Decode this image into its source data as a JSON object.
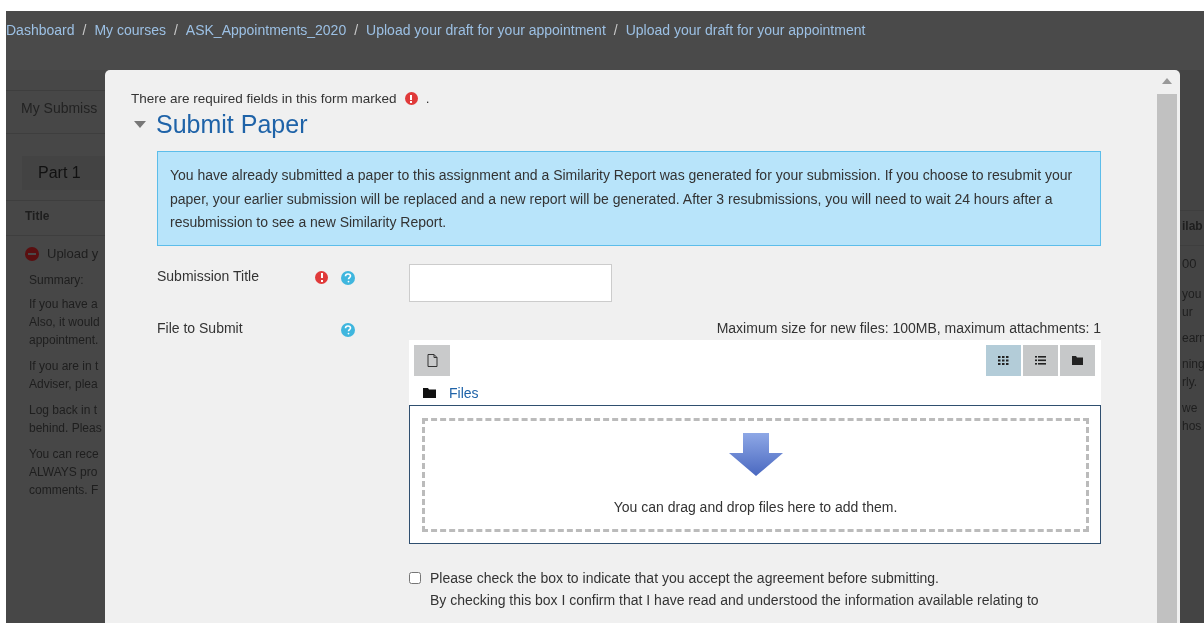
{
  "breadcrumb_separator": "/",
  "breadcrumb": [
    "Dashboard",
    "My courses",
    "ASK_Appointments_2020",
    "Upload your draft for your appointment",
    "Upload your draft for your appointment"
  ],
  "background": {
    "left": [
      {
        "kind": "tab",
        "text": "My Submiss"
      },
      {
        "kind": "part",
        "text": "Part 1"
      },
      {
        "kind": "head",
        "text": "Title"
      },
      {
        "kind": "status",
        "text": "Upload y"
      },
      {
        "kind": "line",
        "text": "Summary:"
      },
      {
        "kind": "para",
        "lines": [
          "If you have a",
          "Also, it would",
          "appointment."
        ]
      },
      {
        "kind": "para",
        "lines": [
          "If you are in t",
          "Adviser, plea"
        ]
      },
      {
        "kind": "para",
        "lines": [
          "Log back in t",
          "behind. Pleas"
        ]
      },
      {
        "kind": "para",
        "lines": [
          "You can rece",
          "ALWAYS pro",
          "comments. F"
        ]
      }
    ],
    "right": [
      {
        "kind": "head",
        "text": "ilab"
      },
      {
        "kind": "status",
        "text": "00"
      },
      {
        "kind": "para",
        "lines": [
          "you",
          "ur"
        ]
      },
      {
        "kind": "para",
        "lines": [
          "earn"
        ]
      },
      {
        "kind": "para",
        "lines": [
          "ning",
          "rly."
        ]
      },
      {
        "kind": "para",
        "lines": [
          "we",
          "hos"
        ]
      }
    ]
  },
  "modal": {
    "required_note": {
      "text": "There are required fields in this form marked",
      "end": "."
    },
    "section": {
      "title": "Submit Paper",
      "expanded": true
    },
    "notice": "You have already submitted a paper to this assignment and a Similarity Report was generated for your submission. If you choose to resubmit your paper, your earlier submission will be replaced and a new report will be generated. After 3 resubmissions, you will need to wait 24 hours after a resubmission to see a new Similarity Report.",
    "fields": [
      {
        "kind": "text",
        "label": "Submission Title",
        "required": true,
        "help": true
      },
      {
        "kind": "filepicker",
        "label": "File to Submit",
        "required": false,
        "help": true
      }
    ],
    "filepicker": {
      "limits": "Maximum size for new files: 100MB, maximum attachments: 1",
      "folder": "Files",
      "views": [
        {
          "kind": "grid",
          "selected": true
        },
        {
          "kind": "list",
          "selected": false
        },
        {
          "kind": "tree",
          "selected": false
        }
      ],
      "drop_text": "You can drag and drop files here to add them."
    },
    "agreement": {
      "checked": false,
      "text": "Please check the box to indicate that you accept the agreement before submitting.",
      "detail": "By checking this box I confirm that I have read and understood the information available relating to"
    }
  }
}
